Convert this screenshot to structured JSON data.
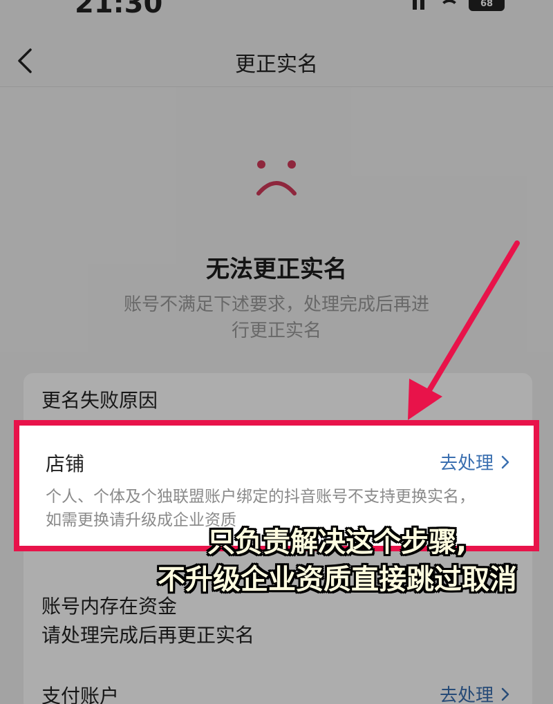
{
  "status_bar": {
    "time": "21:30",
    "battery": "68",
    "icons": [
      "signal-icon",
      "wifi-icon",
      "battery-icon"
    ]
  },
  "nav": {
    "title": "更正实名",
    "back_icon": "chevron-left-icon"
  },
  "result": {
    "icon": "sad-face-icon",
    "title": "无法更正实名",
    "description": "账号不满足下述要求，处理完成后再进行更正实名"
  },
  "reasons": {
    "header": "更名失败原因",
    "shop": {
      "title": "店铺",
      "action": "去处理",
      "description": "个人、个体及个独联盟账户绑定的抖音账号不支持更换实名，如需更换请升级成企业资质"
    },
    "funds": {
      "title": "账号内存在资金",
      "description": "请处理完成后再更正实名"
    },
    "payment": {
      "title": "支付账户",
      "action": "去处理"
    }
  },
  "annotation": {
    "caption_line1": "只负责解决这个步骤,",
    "caption_line2": "不升级企业资质直接跳过取消"
  },
  "colors": {
    "highlight": "#e8134a",
    "link": "#3a6fb0",
    "sad_face": "#d23a5a",
    "caption_text": "#fffde0"
  }
}
